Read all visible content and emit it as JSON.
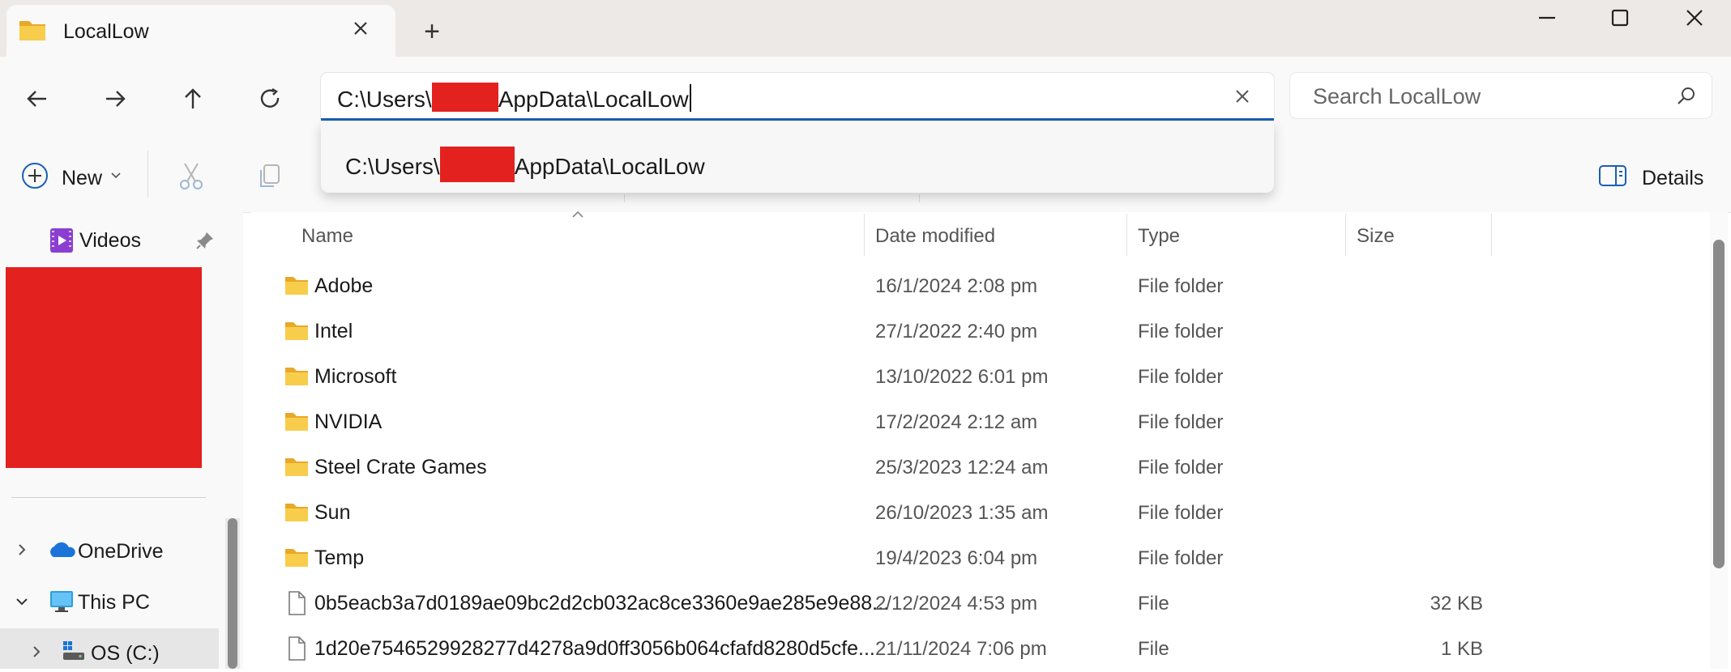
{
  "window": {
    "tab_title": "LocalLow",
    "new_tab_symbol": "+",
    "controls": [
      "minimize-icon",
      "maximize-icon",
      "close-icon"
    ]
  },
  "address_bar": {
    "path_prefix": "C:\\Users\\",
    "path_suffix": "AppData\\LocalLow",
    "suggestion_prefix": "C:\\Users\\",
    "suggestion_suffix": "AppData\\LocalLow"
  },
  "search": {
    "placeholder": "Search LocalLow"
  },
  "command_bar": {
    "new_label": "New",
    "details_label": "Details"
  },
  "sidebar": {
    "videos": "Videos",
    "onedrive": "OneDrive",
    "this_pc": "This PC",
    "os_drive": "OS (C:)"
  },
  "columns": {
    "name": "Name",
    "date": "Date modified",
    "type": "Type",
    "size": "Size"
  },
  "rows": [
    {
      "name": "Adobe",
      "date": "16/1/2024 2:08 pm",
      "type": "File folder",
      "size": "",
      "icon": "folder-icon"
    },
    {
      "name": "Intel",
      "date": "27/1/2022 2:40 pm",
      "type": "File folder",
      "size": "",
      "icon": "folder-icon"
    },
    {
      "name": "Microsoft",
      "date": "13/10/2022 6:01 pm",
      "type": "File folder",
      "size": "",
      "icon": "folder-icon"
    },
    {
      "name": "NVIDIA",
      "date": "17/2/2024 2:12 am",
      "type": "File folder",
      "size": "",
      "icon": "folder-icon"
    },
    {
      "name": "Steel Crate Games",
      "date": "25/3/2023 12:24 am",
      "type": "File folder",
      "size": "",
      "icon": "folder-icon"
    },
    {
      "name": "Sun",
      "date": "26/10/2023 1:35 am",
      "type": "File folder",
      "size": "",
      "icon": "folder-icon"
    },
    {
      "name": "Temp",
      "date": "19/4/2023 6:04 pm",
      "type": "File folder",
      "size": "",
      "icon": "folder-icon"
    },
    {
      "name": "0b5eacb3a7d0189ae09bc2d2cb032ac8ce3360e9ae285e9e88...",
      "date": "2/12/2024 4:53 pm",
      "type": "File",
      "size": "32 KB",
      "icon": "file-icon"
    },
    {
      "name": "1d20e7546529928277d4278a9d0ff3056b064cfafd8280d5cfe...",
      "date": "21/11/2024 7:06 pm",
      "type": "File",
      "size": "1 KB",
      "icon": "file-icon"
    }
  ],
  "colors": {
    "accent": "#1a5fb4",
    "redaction": "#e3211f",
    "folder": "#f5c342"
  }
}
